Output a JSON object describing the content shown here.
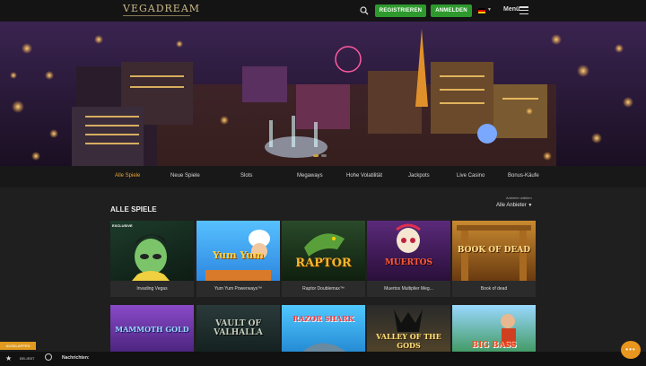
{
  "header": {
    "logo": "VEGADREAM",
    "register_label": "REGISTRIEREN",
    "login_label": "ANMELDEN",
    "menu_label": "Menü",
    "icons": [
      "search-icon",
      "flag-de-icon",
      "hamburger-icon"
    ]
  },
  "hero": {
    "slides": 2,
    "active_slide": 1
  },
  "categories": [
    "Alle Spiele",
    "Neue Spiele",
    "Slots",
    "Megaways",
    "Hohe Volatilität",
    "Jackpots",
    "Live Casino",
    "Bonus-Käufe"
  ],
  "active_category": "Alle Spiele",
  "section": {
    "title": "ALLE SPIELE",
    "provider_label": "Anbieter wählen",
    "provider_value": "Alle Anbieter"
  },
  "games_row1": [
    {
      "name": "Invading Vegas",
      "thumb": "EXCLUSIVE"
    },
    {
      "name": "Yum Yum Powerways™",
      "thumb": "Yum Yum"
    },
    {
      "name": "Raptor Doublemax™",
      "thumb": "RAPTOR"
    },
    {
      "name": "Muertos Multiplier Meg...",
      "thumb": "MUERTOS"
    },
    {
      "name": "Book of dead",
      "thumb": "BOOK OF DEAD"
    }
  ],
  "games_row2": [
    {
      "thumb": "MAMMOTH GOLD"
    },
    {
      "thumb": "VAULT OF VALHALLA"
    },
    {
      "thumb": "RAZOR SHARK"
    },
    {
      "thumb": "VALLEY OF THE GODS"
    },
    {
      "thumb": "BIG BASS"
    }
  ],
  "bottom": {
    "expand_label": "AUSKLAPPEN",
    "popular_label": "BELIEBT",
    "messages_label": "Nachrichten:"
  },
  "colors": {
    "accent": "#e3a437",
    "green": "#2e9a2e",
    "orange": "#e9961e"
  }
}
